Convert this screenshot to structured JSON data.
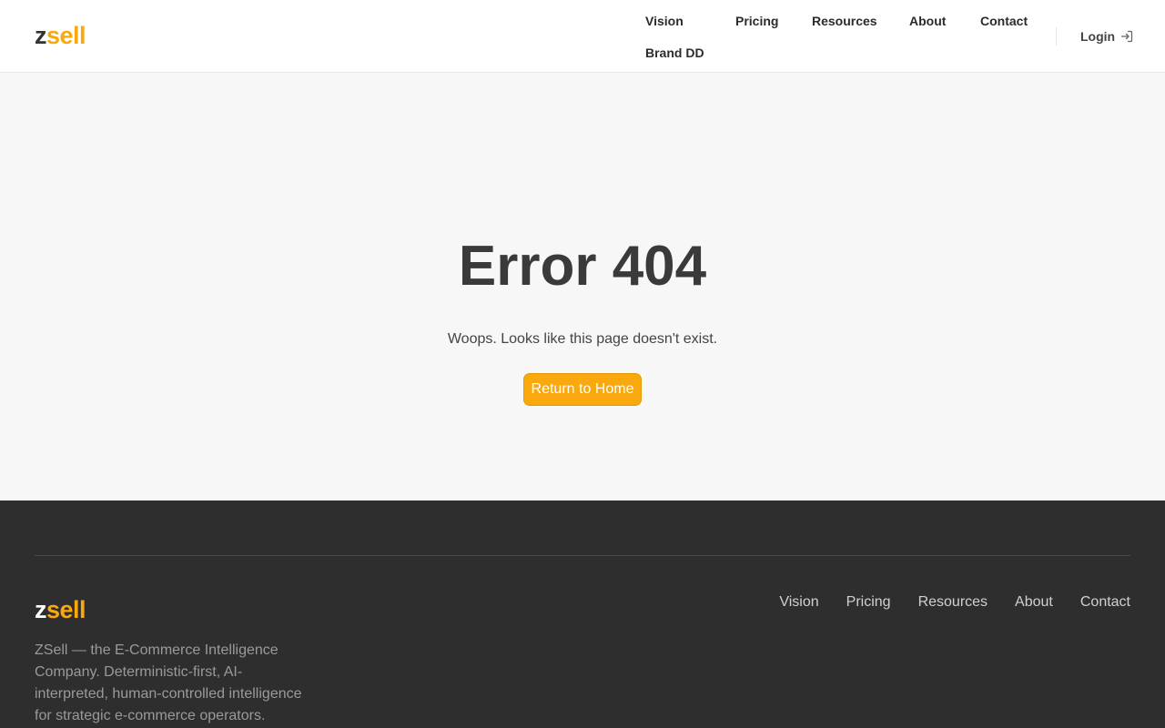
{
  "brand": {
    "logo_prefix": "z",
    "logo_suffix": "sell",
    "accent": "#f9a80d"
  },
  "header": {
    "nav": [
      "Vision",
      "Pricing",
      "Resources",
      "About",
      "Contact",
      "Brand DD"
    ],
    "login_label": "Login",
    "login_icon": "login-arrow-icon"
  },
  "main": {
    "title": "Error 404",
    "message": "Woops. Looks like this page doesn't exist.",
    "button_label": "Return to Home"
  },
  "footer": {
    "description": "ZSell — the E-Commerce Intelligence Company. Deterministic-first, AI-interpreted, human-controlled intelligence for strategic e-commerce operators.",
    "nav": [
      "Vision",
      "Pricing",
      "Resources",
      "About",
      "Contact"
    ]
  }
}
